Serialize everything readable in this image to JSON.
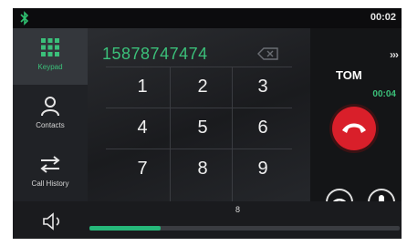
{
  "status_bar": {
    "clock": "00:02",
    "bluetooth_icon": "bluetooth-icon"
  },
  "sidebar": {
    "items": [
      {
        "label": "Keypad",
        "icon": "keypad-icon",
        "active": true
      },
      {
        "label": "Contacts",
        "icon": "contacts-icon",
        "active": false
      },
      {
        "label": "Call History",
        "icon": "call-history-icon",
        "active": false
      }
    ]
  },
  "dialer": {
    "number": "15878747474",
    "keys": [
      "1",
      "2",
      "3",
      "4",
      "5",
      "6",
      "7",
      "8",
      "9"
    ]
  },
  "call": {
    "name": "TOM",
    "more": "›››",
    "duration": "00:04",
    "hangup_color": "#d91f2a"
  },
  "volume": {
    "value": "8",
    "level": 0.23,
    "accent": "#26b87a"
  }
}
